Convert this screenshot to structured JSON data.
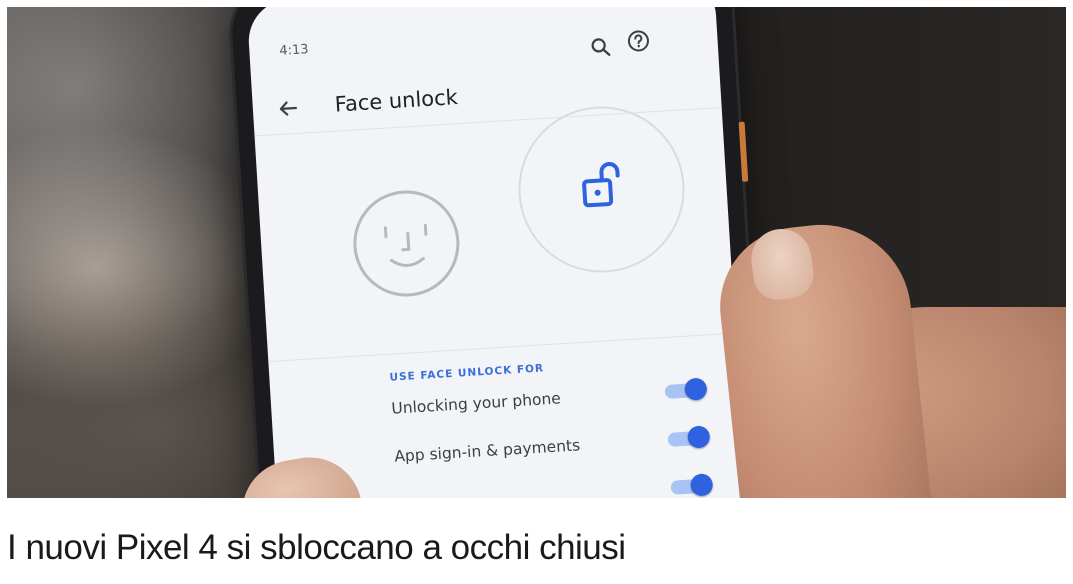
{
  "phone_screen": {
    "status_time": "4:13",
    "title": "Face unlock",
    "section_header": "USE FACE UNLOCK FOR",
    "settings": [
      {
        "label": "Unlocking your phone",
        "enabled": true
      },
      {
        "label": "App sign-in & payments",
        "enabled": true
      },
      {
        "label": "",
        "enabled": true
      }
    ],
    "icons": [
      "back-arrow-icon",
      "search-icon",
      "help-icon",
      "face-icon",
      "unlock-icon"
    ],
    "accent_color": "#2f62e0"
  },
  "article": {
    "headline": "I nuovi Pixel 4 si sbloccano a occhi chiusi"
  }
}
